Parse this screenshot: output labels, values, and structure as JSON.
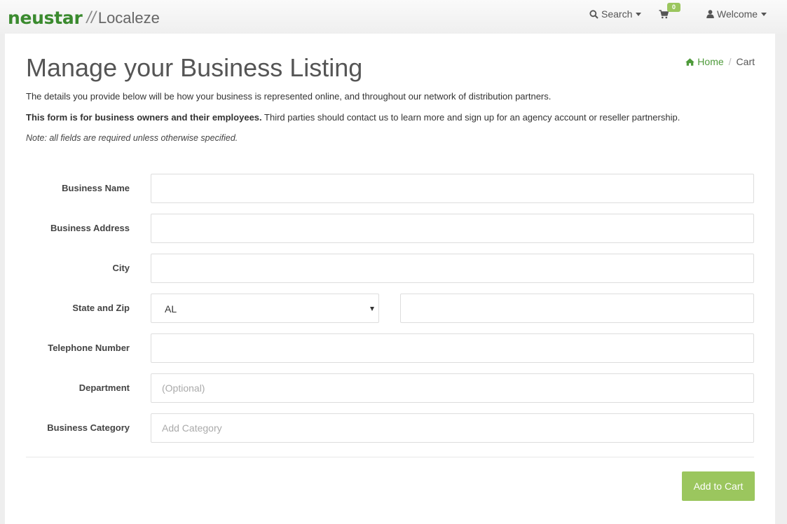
{
  "brand": {
    "name": "neustar",
    "product": "Localeze"
  },
  "nav": {
    "search_label": "Search",
    "cart_count": "0",
    "welcome_label": "Welcome"
  },
  "breadcrumb": {
    "home": "Home",
    "current": "Cart"
  },
  "page": {
    "title": "Manage your Business Listing",
    "intro": "The details you provide below will be how your business is represented online, and throughout our network of distribution partners.",
    "owners_bold": "This form is for business owners and their employees.",
    "owners_rest": " Third parties should contact us to learn more and sign up for an agency account or reseller partnership.",
    "note": "Note: all fields are required unless otherwise specified."
  },
  "form": {
    "business_name": {
      "label": "Business Name",
      "value": "",
      "placeholder": ""
    },
    "business_address": {
      "label": "Business Address",
      "value": "",
      "placeholder": ""
    },
    "city": {
      "label": "City",
      "value": "",
      "placeholder": ""
    },
    "state_zip": {
      "label": "State and Zip",
      "state_value": "AL",
      "zip_value": "",
      "zip_placeholder": ""
    },
    "telephone": {
      "label": "Telephone Number",
      "value": "",
      "placeholder": ""
    },
    "department": {
      "label": "Department",
      "value": "",
      "placeholder": "(Optional)"
    },
    "category": {
      "label": "Business Category",
      "value": "",
      "placeholder": "Add Category"
    },
    "submit_label": "Add to Cart"
  },
  "colors": {
    "brand_green": "#3a8a2e",
    "accent_green": "#9bc65e",
    "link_green": "#4e9a3a"
  },
  "icons": {
    "search": "search-icon",
    "cart": "shopping-cart-icon",
    "user": "user-icon",
    "home": "home-icon"
  }
}
